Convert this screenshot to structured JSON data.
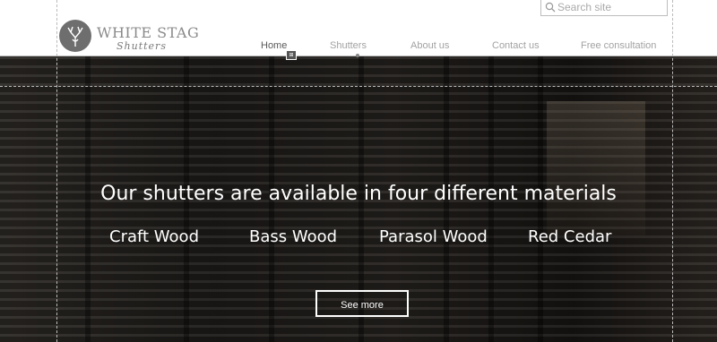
{
  "brand": {
    "title": "WHITE STAG",
    "subtitle": "Shutters"
  },
  "search": {
    "placeholder": "Search site"
  },
  "nav": {
    "items": [
      {
        "label": "Home"
      },
      {
        "label": "Shutters"
      },
      {
        "label": "About us"
      },
      {
        "label": "Contact us"
      },
      {
        "label": "Free consultation"
      }
    ]
  },
  "hero": {
    "headline": "Our shutters are available in four different materials",
    "materials": [
      "Craft Wood",
      "Bass Wood",
      "Parasol Wood",
      "Red Cedar"
    ],
    "cta_label": "See more"
  }
}
